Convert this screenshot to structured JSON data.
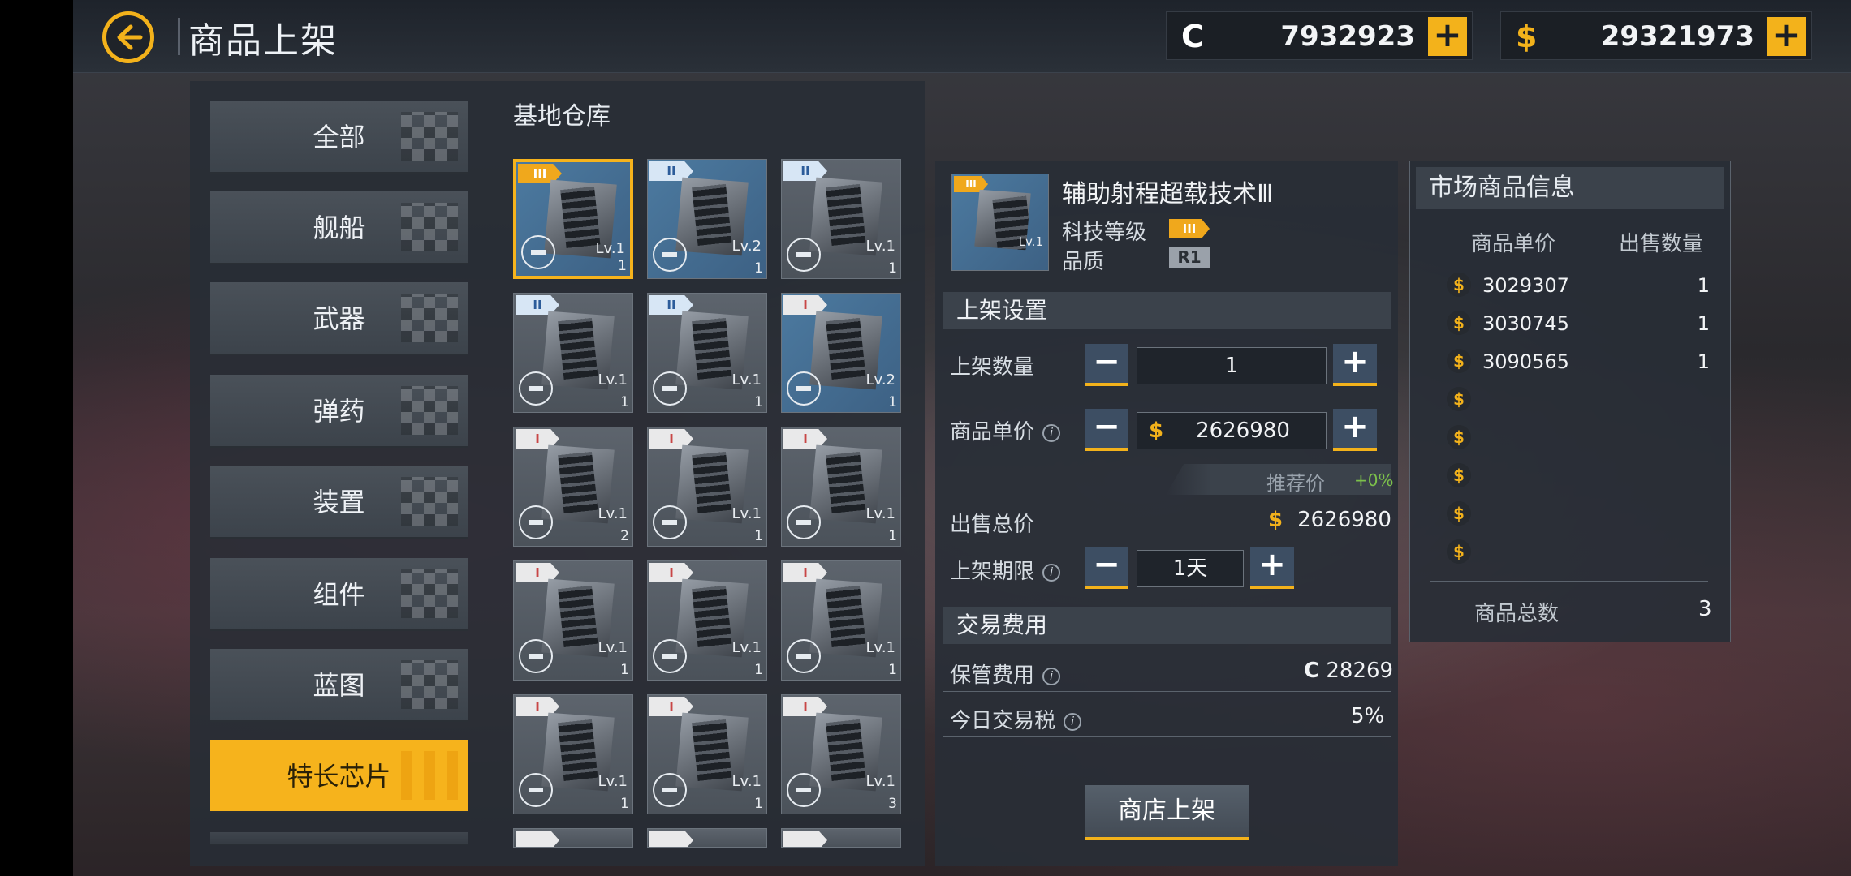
{
  "header": {
    "title": "商品上架",
    "credits_symbol": "C",
    "credits": "7932923",
    "gold_symbol": "$",
    "gold": "29321973",
    "add": "+"
  },
  "categories": [
    "全部",
    "舰船",
    "武器",
    "弹药",
    "装置",
    "组件",
    "蓝图",
    "特长芯片"
  ],
  "active_category": "特长芯片",
  "warehouse": {
    "title": "基地仓库",
    "items": [
      {
        "tier": "III",
        "level": "Lv.1",
        "count": "1",
        "style": "blue",
        "selected": true
      },
      {
        "tier": "II",
        "level": "Lv.2",
        "count": "1",
        "style": "blue"
      },
      {
        "tier": "II",
        "level": "Lv.1",
        "count": "1",
        "style": "gray"
      },
      {
        "tier": "II",
        "level": "Lv.1",
        "count": "1",
        "style": "gray"
      },
      {
        "tier": "II",
        "level": "Lv.1",
        "count": "1",
        "style": "gray"
      },
      {
        "tier": "I",
        "level": "Lv.2",
        "count": "1",
        "style": "blue"
      },
      {
        "tier": "I",
        "level": "Lv.1",
        "count": "2",
        "style": "gray"
      },
      {
        "tier": "I",
        "level": "Lv.1",
        "count": "1",
        "style": "gray"
      },
      {
        "tier": "I",
        "level": "Lv.1",
        "count": "1",
        "style": "gray"
      },
      {
        "tier": "I",
        "level": "Lv.1",
        "count": "1",
        "style": "gray"
      },
      {
        "tier": "I",
        "level": "Lv.1",
        "count": "1",
        "style": "gray"
      },
      {
        "tier": "I",
        "level": "Lv.1",
        "count": "1",
        "style": "gray"
      },
      {
        "tier": "I",
        "level": "Lv.1",
        "count": "1",
        "style": "gray"
      },
      {
        "tier": "I",
        "level": "Lv.1",
        "count": "1",
        "style": "gray"
      },
      {
        "tier": "I",
        "level": "Lv.1",
        "count": "3",
        "style": "gray"
      }
    ]
  },
  "detail": {
    "name": "辅助射程超载技术Ⅲ",
    "tier": "III",
    "level": "Lv.1",
    "tech_label": "科技等级",
    "quality_label": "品质",
    "quality": "R1"
  },
  "listing": {
    "section": "上架设置",
    "qty_label": "上架数量",
    "qty": "1",
    "price_label": "商品单价",
    "price": "2626980",
    "recommend_label": "推荐价",
    "recommend_pct": "+0%",
    "total_label": "出售总价",
    "total": "2626980",
    "duration_label": "上架期限",
    "duration": "1天",
    "minus": "−",
    "plus": "+",
    "coin": "$"
  },
  "fees": {
    "section": "交易费用",
    "storage_label": "保管费用",
    "storage_symbol": "C",
    "storage": "28269",
    "tax_label": "今日交易税",
    "tax": "5%"
  },
  "submit": "商店上架",
  "market": {
    "title": "市场商品信息",
    "col_price": "商品单价",
    "col_qty": "出售数量",
    "rows": [
      {
        "price": "3029307",
        "qty": "1"
      },
      {
        "price": "3030745",
        "qty": "1"
      },
      {
        "price": "3090565",
        "qty": "1"
      },
      {
        "price": "",
        "qty": ""
      },
      {
        "price": "",
        "qty": ""
      },
      {
        "price": "",
        "qty": ""
      },
      {
        "price": "",
        "qty": ""
      },
      {
        "price": "",
        "qty": ""
      }
    ],
    "total_label": "商品总数",
    "total": "3",
    "coin": "$"
  }
}
